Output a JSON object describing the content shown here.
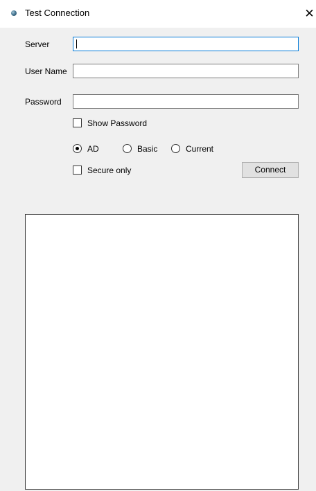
{
  "window": {
    "title": "Test Connection",
    "close_glyph": "✕"
  },
  "form": {
    "server_label": "Server",
    "server_value": "",
    "username_label": "User Name",
    "username_value": "",
    "password_label": "Password",
    "password_value": "",
    "show_password_label": "Show Password",
    "show_password_checked": false,
    "auth_options": [
      {
        "label": "AD",
        "selected": true
      },
      {
        "label": "Basic",
        "selected": false
      },
      {
        "label": "Current",
        "selected": false
      }
    ],
    "secure_only_label": "Secure only",
    "secure_only_checked": false,
    "connect_label": "Connect"
  },
  "output": {
    "text": ""
  },
  "icons": {
    "app": "app-icon",
    "close": "close-icon"
  },
  "colors": {
    "window_bg": "#f0f0f0",
    "titlebar_bg": "#ffffff",
    "focus_border": "#0078d7",
    "button_bg": "#e1e1e1"
  }
}
